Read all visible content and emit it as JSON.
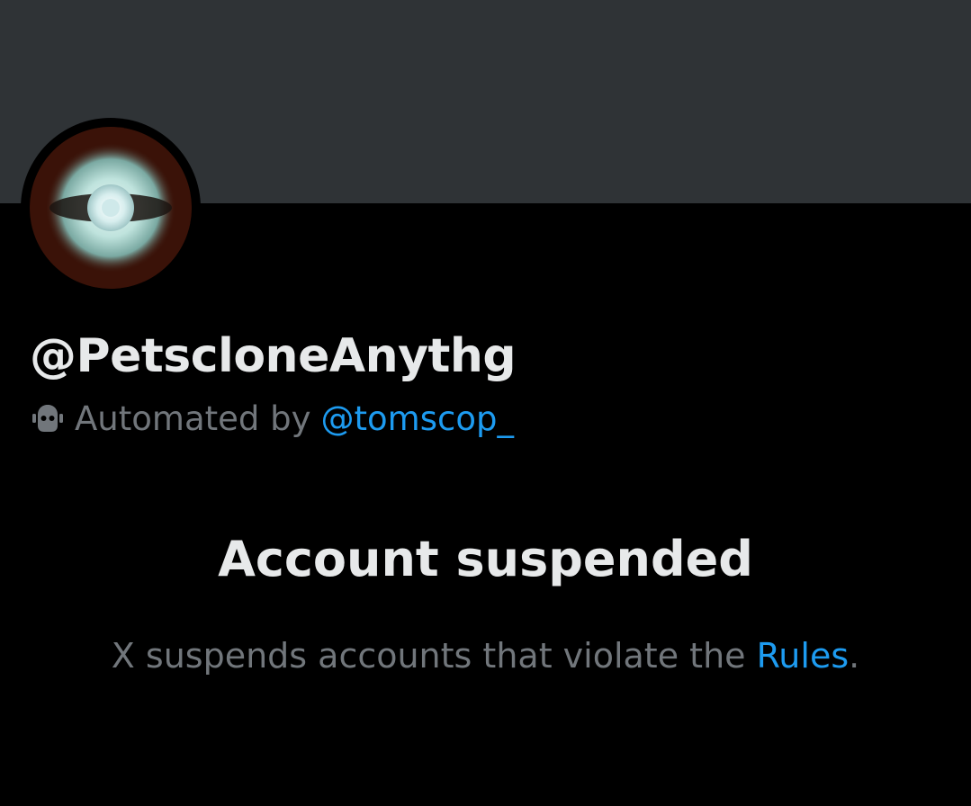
{
  "profile": {
    "handle": "@PetscloneAnythg",
    "avatar_icon": "eye-avatar-image",
    "automated_label": "Automated by",
    "automated_by_handle": "@tomscop_",
    "automated_icon": "bot-icon"
  },
  "suspension": {
    "title": "Account suspended",
    "message_prefix": "X suspends accounts that violate the ",
    "rules_link": "Rules",
    "message_suffix": "."
  },
  "colors": {
    "background": "#000000",
    "banner": "#2f3336",
    "primary_text": "#e7e9ea",
    "secondary_text": "#71767b",
    "link": "#1d9bf0"
  }
}
